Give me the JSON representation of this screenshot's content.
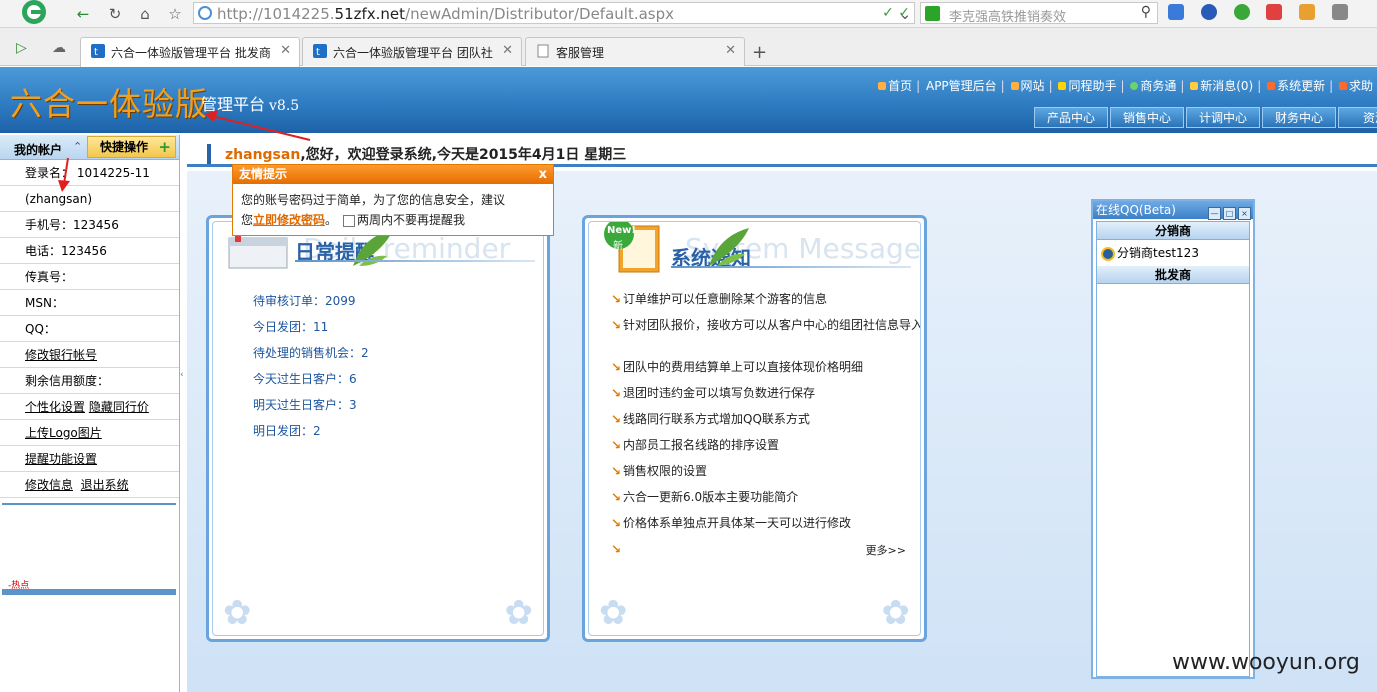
{
  "browser": {
    "url_prefix": "http://1014225.",
    "url_domain": "51zfx.net",
    "url_path": "/newAdmin/Distributor/Default.aspx",
    "search_placeholder": "李克强高铁推销奏效",
    "tabs": [
      {
        "label": "六合一体验版管理平台 批发商"
      },
      {
        "label": "六合一体验版管理平台 团队社"
      },
      {
        "label": "客服管理"
      }
    ]
  },
  "header": {
    "title": "六合一体验版",
    "subtitle": "管理平台",
    "version": "v8.5",
    "top_links": [
      "首页",
      "APP管理后台",
      "网站",
      "同程助手",
      "商务通",
      "新消息(0)",
      "系统更新",
      "求助"
    ],
    "nav": [
      "产品中心",
      "销售中心",
      "计调中心",
      "财务中心",
      "资源"
    ]
  },
  "sidebar": {
    "tab_account": "我的帐户",
    "tab_quick": "快捷操作",
    "rows": [
      {
        "label": "登录名：",
        "value": "1014225-11"
      },
      {
        "label": "(zhangsan)",
        "value": ""
      },
      {
        "label": "手机号：",
        "value": "123456"
      },
      {
        "label": "电话：",
        "value": "123456"
      },
      {
        "label": "传真号：",
        "value": ""
      },
      {
        "label": "MSN：",
        "value": ""
      },
      {
        "label": "QQ：",
        "value": ""
      },
      {
        "label": "剩余信用额度：",
        "value": ""
      }
    ],
    "links": {
      "bank": "修改银行帐号",
      "personalize": "个性化设置",
      "hide_peer_price": "隐藏同行价",
      "upload_logo": "上传Logo图片",
      "remind_settings": "提醒功能设置",
      "edit_info": "修改信息",
      "logout": "退出系统"
    },
    "hot": "-热点"
  },
  "greeting": {
    "user": "zhangsan",
    "text": ",您好，欢迎登录系统,今天是2015年4月1日  星期三"
  },
  "popup": {
    "title": "友情提示",
    "close": "x",
    "line1": "您的账号密码过于简单，为了您的信息安全，建议",
    "line2_prefix": "您",
    "link": "立即修改密码",
    "line2_suffix": "。",
    "checkbox_label": "两周内不要再提醒我"
  },
  "reminder": {
    "title_zh": "日常提醒",
    "title_en": "Daily reminder",
    "items": [
      {
        "label": "待审核订单：2099"
      },
      {
        "label": "今日发团：11"
      },
      {
        "label": "待处理的销售机会：2"
      },
      {
        "label": "今天过生日客户：6"
      },
      {
        "label": "明天过生日客户：3"
      },
      {
        "label": "明日发团：2"
      }
    ]
  },
  "notice": {
    "title_zh": "系统通知",
    "title_en": "System Message",
    "badge": "New!",
    "badge_sub": "新",
    "items": [
      "订单维护可以任意删除某个游客的信息",
      "针对团队报价，接收方可以从客户中心的组团社信息导入",
      "团队中的费用结算单上可以直接体现价格明细",
      "退团时违约金可以填写负数进行保存",
      "线路同行联系方式增加QQ联系方式",
      "内部员工报名线路的排序设置",
      "销售权限的设置",
      "六合一更新6.0版本主要功能简介",
      "价格体系单独点开具体某一天可以进行修改",
      ""
    ],
    "more": "更多>>"
  },
  "qq": {
    "title": "在线QQ(Beta)",
    "sec_distributor": "分销商",
    "distributor_item": "分销商test123",
    "sec_wholesaler": "批发商"
  },
  "watermark": "www.wooyun.org",
  "colors": {
    "brand_blue": "#2f7cc2",
    "accent_orange": "#e56d00",
    "title_gold": "#f0a020"
  }
}
